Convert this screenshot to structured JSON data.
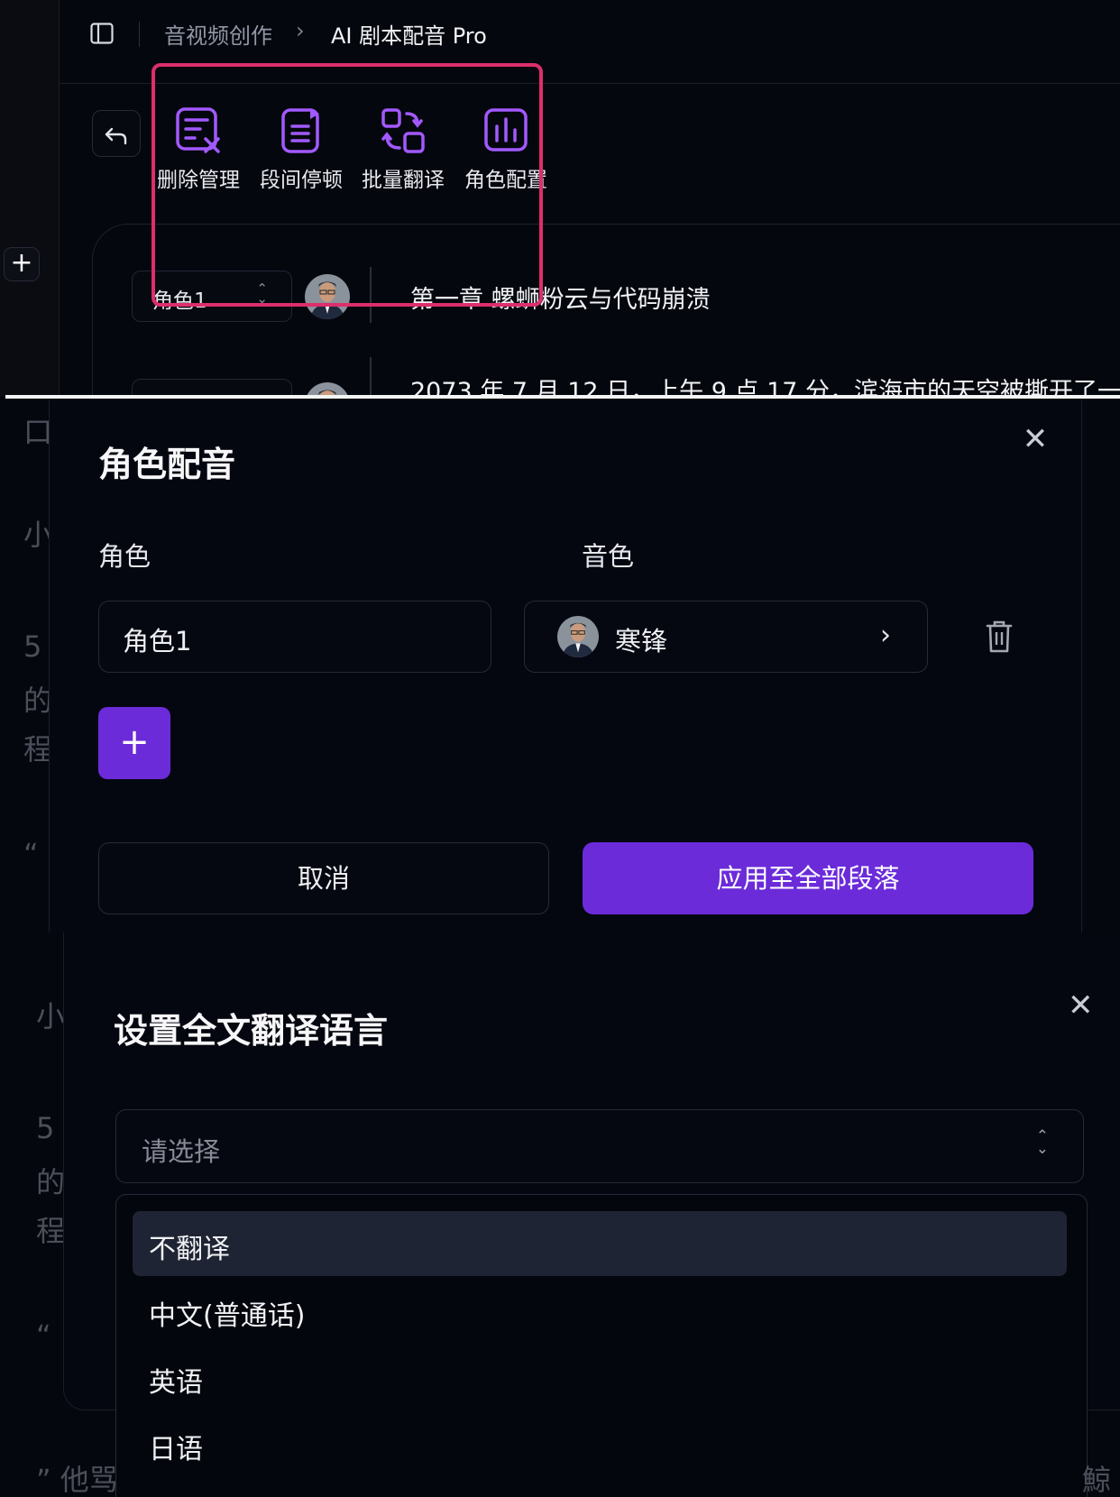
{
  "colors": {
    "accent": "#6b2bd9",
    "highlight_border": "#dc2f6b",
    "icon_purple": "#a259ff",
    "bg": "#05070e"
  },
  "panel1": {
    "breadcrumb": {
      "parent": "音视频创作",
      "current": "AI 剧本配音 Pro"
    },
    "toolbar": [
      {
        "label": "删除管理",
        "icon": "delete-manage-icon"
      },
      {
        "label": "段间停顿",
        "icon": "pause-icon"
      },
      {
        "label": "批量翻译",
        "icon": "translate-icon"
      },
      {
        "label": "角色配置",
        "icon": "role-config-icon"
      }
    ],
    "segments": [
      {
        "role": "角色1",
        "text": "第一章 螺蛳粉云与代码崩溃"
      },
      {
        "role": "",
        "text": "2073 年 7 月 12 日，上午 9 点 17 分，滨海市的天空被撕开了一"
      }
    ]
  },
  "panel2": {
    "title": "角色配音",
    "role_header": "角色",
    "voice_header": "音色",
    "role_value": "角色1",
    "voice_value": "寒锋",
    "add_label": "+",
    "cancel_label": "取消",
    "apply_label": "应用至全部段落",
    "bg_chars": [
      "口",
      "小",
      "5",
      "的",
      "程",
      "“"
    ]
  },
  "panel3": {
    "title": "设置全文翻译语言",
    "placeholder": "请选择",
    "options": [
      "不翻译",
      "中文(普通话)",
      "英语",
      "日语"
    ],
    "bg_chars": [
      "小",
      "5",
      "的",
      "程",
      "“"
    ],
    "bottom_left": "” 他骂",
    "bottom_right": "鯨"
  }
}
